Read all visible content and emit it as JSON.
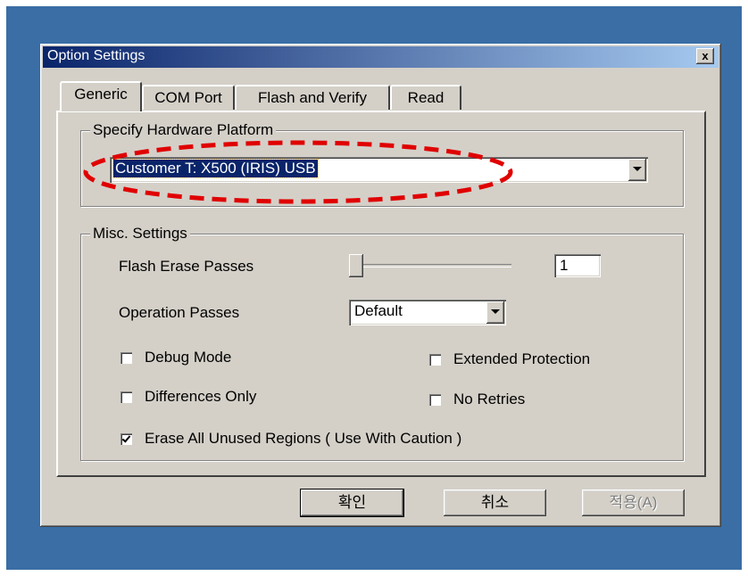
{
  "window": {
    "title": "Option Settings",
    "close_label": "x"
  },
  "tabs": [
    {
      "label": "Generic",
      "active": true
    },
    {
      "label": "COM Port",
      "active": false
    },
    {
      "label": "Flash and Verify",
      "active": false
    },
    {
      "label": "Read",
      "active": false
    }
  ],
  "hardware": {
    "group_title": "Specify Hardware Platform",
    "selected_value": "Customer T: X500 (IRIS) USB"
  },
  "misc": {
    "group_title": "Misc. Settings",
    "flash_erase_label": "Flash Erase Passes",
    "flash_erase_value": "1",
    "operation_passes_label": "Operation Passes",
    "operation_passes_value": "Default",
    "checkboxes": {
      "debug_mode": {
        "label": "Debug Mode",
        "checked": false
      },
      "extended_protection": {
        "label": "Extended Protection",
        "checked": false
      },
      "differences_only": {
        "label": "Differences Only",
        "checked": false
      },
      "no_retries": {
        "label": "No Retries",
        "checked": false
      },
      "erase_unused": {
        "label": "Erase All Unused Regions ( Use With Caution )",
        "checked": true
      }
    }
  },
  "buttons": {
    "ok": "확인",
    "cancel": "취소",
    "apply": "적용(A)"
  },
  "colors": {
    "desktop": "#3a6ea5",
    "dialog": "#d4d0c8",
    "titlebar": "#0a246a",
    "annotation": "#e00000"
  }
}
